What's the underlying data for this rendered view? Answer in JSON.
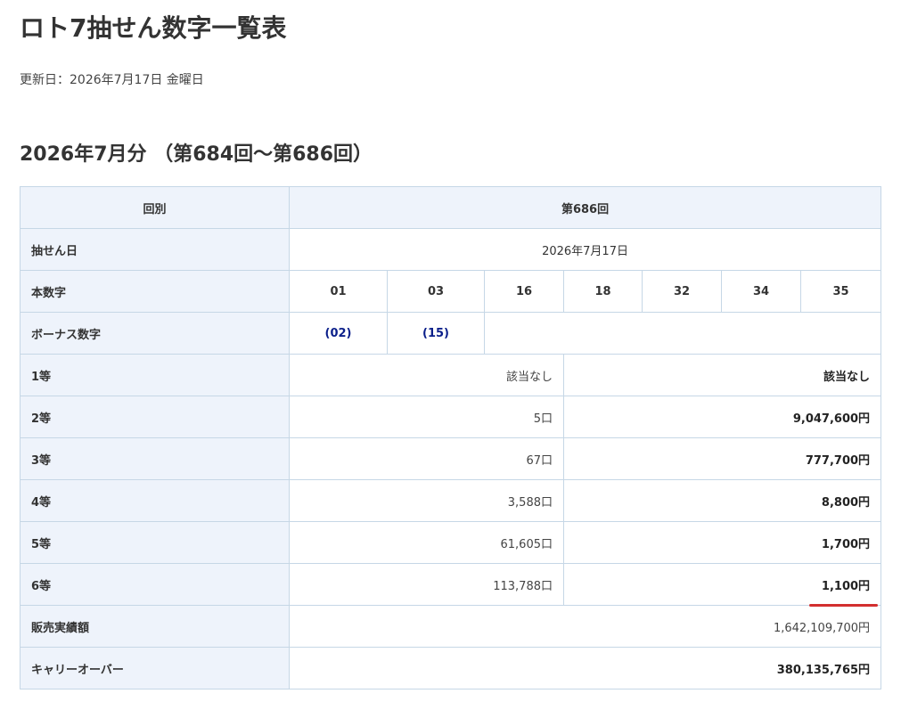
{
  "page": {
    "title": "ロト7抽せん数字一覧表",
    "updated": "更新日：2026年7月17日 金曜日",
    "section_title": "2026年7月分 （第684回〜第686回）"
  },
  "table": {
    "header": {
      "label": "回別",
      "value": "第686回"
    },
    "draw_date": {
      "label": "抽せん日",
      "value": "2026年7月17日"
    },
    "main_numbers": {
      "label": "本数字",
      "values": [
        "01",
        "03",
        "16",
        "18",
        "32",
        "34",
        "35"
      ]
    },
    "bonus_numbers": {
      "label": "ボーナス数字",
      "values": [
        "(02)",
        "(15)"
      ]
    },
    "prizes": [
      {
        "label": "1等",
        "count": "該当なし",
        "amount": "該当なし"
      },
      {
        "label": "2等",
        "count": "5口",
        "amount": "9,047,600円"
      },
      {
        "label": "3等",
        "count": "67口",
        "amount": "777,700円"
      },
      {
        "label": "4等",
        "count": "3,588口",
        "amount": "8,800円"
      },
      {
        "label": "5等",
        "count": "61,605口",
        "amount": "1,700円"
      },
      {
        "label": "6等",
        "count": "113,788口",
        "amount": "1,100円"
      }
    ],
    "sales": {
      "label": "販売実績額",
      "value": "1,642,109,700円"
    },
    "carryover": {
      "label": "キャリーオーバー",
      "value": "380,135,765円"
    }
  },
  "colors": {
    "accent_underline": "#d32f2f",
    "header_bg": "#eef3fb",
    "bonus_text": "#0b1f8a",
    "border": "#c6d7e6"
  }
}
